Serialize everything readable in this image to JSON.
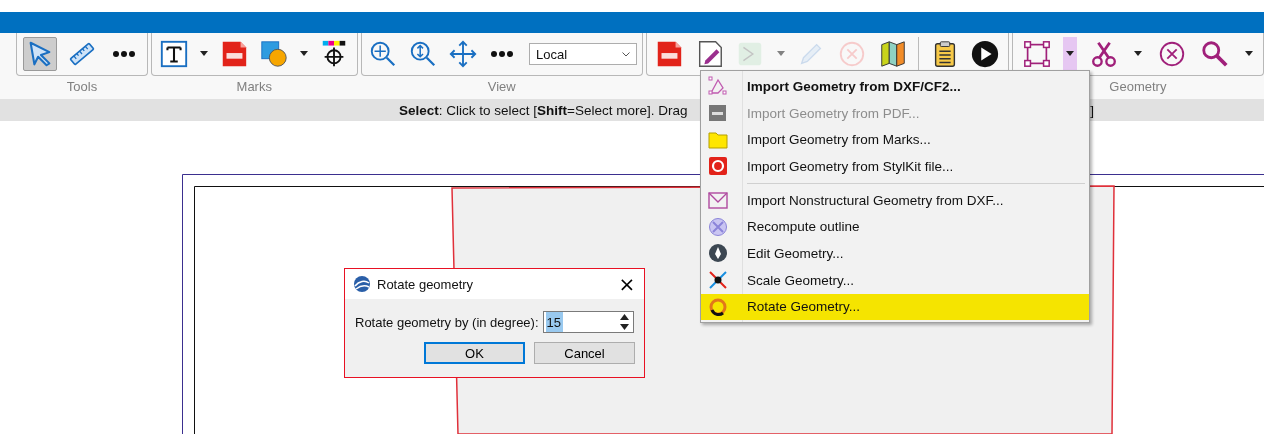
{
  "toolbar": {
    "groups": [
      {
        "label": "Tools",
        "tools": [
          {
            "kind": "select",
            "pressed": true,
            "disabled": false
          },
          {
            "kind": "ruler",
            "pressed": false,
            "disabled": false
          },
          {
            "kind": "more",
            "pressed": false,
            "disabled": false
          }
        ]
      },
      {
        "label": "Marks",
        "tools": [
          {
            "kind": "text",
            "pressed": false,
            "disabled": false,
            "dropdown": true
          },
          {
            "kind": "pdf",
            "pressed": false,
            "disabled": false
          },
          {
            "kind": "shapes",
            "pressed": false,
            "disabled": false,
            "dropdown": true
          },
          {
            "kind": "registration",
            "pressed": false,
            "disabled": false
          }
        ]
      },
      {
        "label": "View",
        "tools": [
          {
            "kind": "zoom-fit",
            "pressed": false,
            "disabled": false
          },
          {
            "kind": "zoom-vertical",
            "pressed": false,
            "disabled": false
          },
          {
            "kind": "pan",
            "pressed": false,
            "disabled": false
          },
          {
            "kind": "more",
            "pressed": false,
            "disabled": false
          },
          {
            "kind": "select-box",
            "value": "Local"
          }
        ]
      },
      {
        "tools": [
          {
            "kind": "pdf",
            "pressed": false,
            "disabled": false
          },
          {
            "kind": "edit-doc",
            "pressed": false,
            "disabled": false
          },
          {
            "kind": "gradient",
            "pressed": false,
            "disabled": true,
            "dropdown": true
          },
          {
            "kind": "pencil",
            "pressed": false,
            "disabled": true
          },
          {
            "kind": "cancel",
            "pressed": false,
            "disabled": true
          },
          {
            "kind": "map",
            "pressed": false,
            "disabled": false
          },
          {
            "kind": "separator"
          },
          {
            "kind": "clipboard",
            "pressed": false,
            "disabled": false
          },
          {
            "kind": "play",
            "pressed": false,
            "disabled": false
          }
        ]
      },
      {
        "label": "Geometry",
        "tools": [
          {
            "kind": "bounding-box",
            "pressed": false,
            "disabled": false,
            "dropdown": true,
            "dropdown_open": true
          },
          {
            "kind": "scissors",
            "pressed": false,
            "disabled": false,
            "dropdown": true
          },
          {
            "kind": "remove",
            "pressed": false,
            "disabled": false
          },
          {
            "kind": "search",
            "pressed": false,
            "disabled": false,
            "dropdown": true
          }
        ]
      }
    ]
  },
  "status_bar": {
    "text": "**Select**: Click to select [**Shift**=Select more]. Drag",
    "text_end": "]"
  },
  "menu": {
    "items": [
      {
        "label": "Import Geometry from DXF/CF2...",
        "bold": true,
        "disabled": false,
        "selected": false,
        "separator_before": false
      },
      {
        "label": "Import Geometry from PDF...",
        "bold": false,
        "disabled": true,
        "selected": false,
        "separator_before": false
      },
      {
        "label": "Import Geometry from Marks...",
        "bold": false,
        "disabled": false,
        "selected": false,
        "separator_before": false
      },
      {
        "label": "Import Geometry from StylKit file...",
        "bold": false,
        "disabled": false,
        "selected": false,
        "separator_before": false
      },
      {
        "label": "Import Nonstructural Geometry from DXF...",
        "bold": false,
        "disabled": false,
        "selected": false,
        "separator_before": true
      },
      {
        "label": "Recompute outline",
        "bold": false,
        "disabled": false,
        "selected": false,
        "separator_before": false
      },
      {
        "label": "Edit Geometry...",
        "bold": false,
        "disabled": false,
        "selected": false,
        "separator_before": false
      },
      {
        "label": "Scale Geometry...",
        "bold": false,
        "disabled": false,
        "selected": false,
        "separator_before": false
      },
      {
        "label": "Rotate Geometry...",
        "bold": false,
        "disabled": false,
        "selected": true,
        "separator_before": false
      }
    ]
  },
  "dialog": {
    "title": "Rotate geometry",
    "close": "×",
    "field_label": "Rotate geometry by (in degree):",
    "value": "15",
    "value_selected": true,
    "buttons": [
      {
        "label": "OK",
        "default": true
      },
      {
        "label": "Cancel",
        "default": false
      }
    ]
  }
}
